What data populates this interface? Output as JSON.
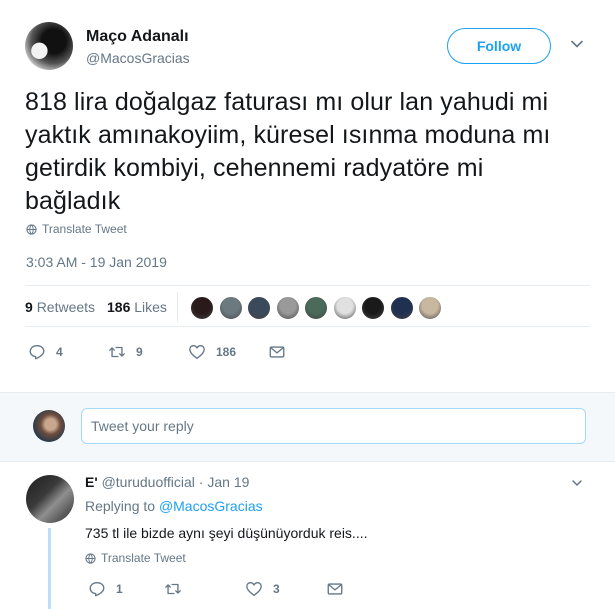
{
  "tweet": {
    "author_name": "Maço Adanalı",
    "author_handle": "@MacosGracias",
    "follow_label": "Follow",
    "text": "818 lira doğalgaz faturası mı olur lan yahudi mi yaktık amınakoyiim, küresel ısınma moduna mı getirdik kombiyi, cehennemi radyatöre mi bağladık",
    "translate_label": "Translate Tweet",
    "timestamp": "3:03 AM - 19 Jan 2019",
    "retweets_count": "9",
    "retweets_label": "Retweets",
    "likes_count": "186",
    "likes_label": "Likes",
    "liker_colors": [
      "#2a1a1a",
      "#6c7a80",
      "#3b4a5a",
      "#999999",
      "#4a6a5a",
      "#e0e0e0",
      "#1a1a1a",
      "#203050",
      "#c9b8a0"
    ],
    "actions": {
      "reply_count": "4",
      "retweet_count": "9",
      "like_count": "186"
    }
  },
  "reply_box": {
    "placeholder": "Tweet your reply"
  },
  "reply": {
    "author_name": "E'",
    "author_handle": "@turuduofficial",
    "separator": "·",
    "date": "Jan 19",
    "replying_to_label": "Replying to",
    "replying_to_handle": "@MacosGracias",
    "text": "735 tl ile bizde aynı şeyi düşünüyorduk reis....",
    "translate_label": "Translate Tweet",
    "actions": {
      "reply_count": "1",
      "retweet_count": "",
      "like_count": "3"
    }
  },
  "colors": {
    "accent": "#1da1f2",
    "muted": "#657786",
    "text": "#14171a",
    "border": "#e6ecf0"
  }
}
